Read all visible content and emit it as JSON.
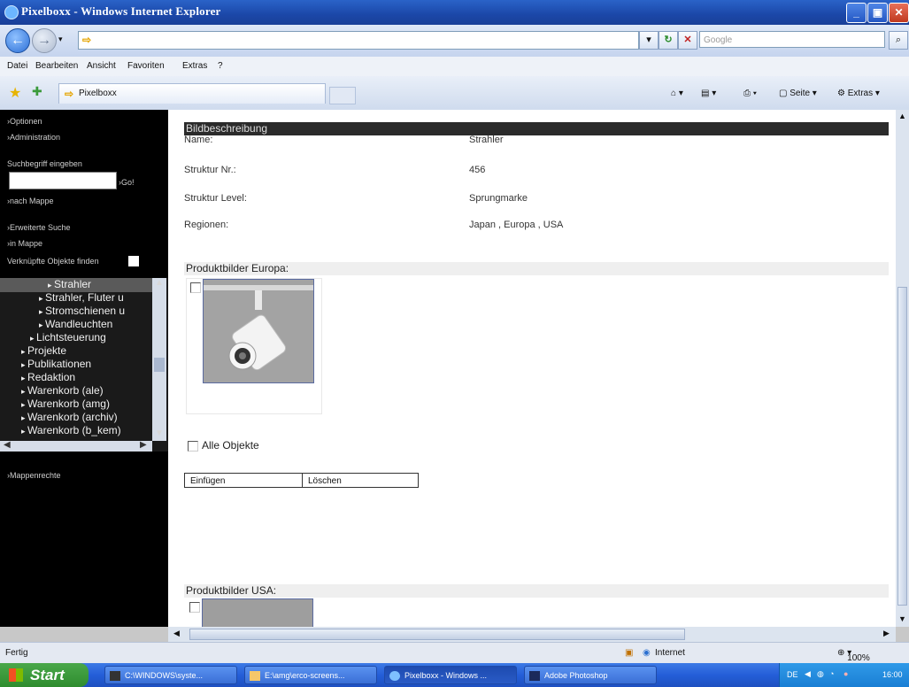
{
  "window": {
    "title": "Pixelboxx - Windows Internet Explorer"
  },
  "address": {
    "value": "",
    "search_placeholder": "Google"
  },
  "menu": [
    "Datei",
    "Bearbeiten",
    "Ansicht",
    "Favoriten",
    "Extras",
    "?"
  ],
  "tab": {
    "label": "Pixelboxx"
  },
  "commandbar": {
    "page_label": "Seite",
    "tools_label": "Extras"
  },
  "sidebar": {
    "options": "›Optionen",
    "admin": "›Administration",
    "search_label": "Suchbegriff eingeben",
    "go": "›Go!",
    "by_folder": "›nach Mappe",
    "advanced": "›Erweiterte Suche",
    "in_folder": "›in Mappe",
    "linked": "Verknüpfte Objekte finden",
    "folder_rights": "›Mappenrechte",
    "tree": [
      {
        "label": "Strahler",
        "indent": 4,
        "selected": true
      },
      {
        "label": "Strahler, Fluter u",
        "indent": 3
      },
      {
        "label": "Stromschienen u",
        "indent": 3
      },
      {
        "label": "Wandleuchten",
        "indent": 3
      },
      {
        "label": "Lichtsteuerung",
        "indent": 2
      },
      {
        "label": "Projekte",
        "indent": 1
      },
      {
        "label": "Publikationen",
        "indent": 1
      },
      {
        "label": "Redaktion",
        "indent": 1
      },
      {
        "label": "Warenkorb (ale)",
        "indent": 1
      },
      {
        "label": "Warenkorb (amg)",
        "indent": 1
      },
      {
        "label": "Warenkorb (archiv)",
        "indent": 1
      },
      {
        "label": "Warenkorb (b_kem)",
        "indent": 1
      }
    ]
  },
  "detail": {
    "header": "Bildbeschreibung",
    "fields": [
      {
        "label": "Name:",
        "value": "Strahler"
      },
      {
        "label": "Struktur Nr.:",
        "value": "456"
      },
      {
        "label": "Struktur Level:",
        "value": "Sprungmarke"
      },
      {
        "label": "Regionen:",
        "value": "Japan , Europa , USA"
      }
    ],
    "europe_header": "Produktbilder Europa:",
    "all_objects": "Alle Objekte",
    "insert_button": "Einfügen",
    "delete_button": "Löschen",
    "usa_header": "Produktbilder USA:"
  },
  "status": {
    "left": "Fertig",
    "zone": "Internet",
    "zoom": "100%"
  },
  "taskbar": {
    "start": "Start",
    "tasks": [
      "C:\\WINDOWS\\syste...",
      "E:\\amg\\erco-screens...",
      "Pixelboxx - Windows ...",
      "Adobe Photoshop"
    ],
    "tray_lang": "DE",
    "clock": "16:00"
  },
  "colors": {
    "sidebar_bg": "#000000",
    "section_header_bg": "#2b2b2b",
    "titlebar": "#1b47a8",
    "taskbar": "#245ed8"
  }
}
